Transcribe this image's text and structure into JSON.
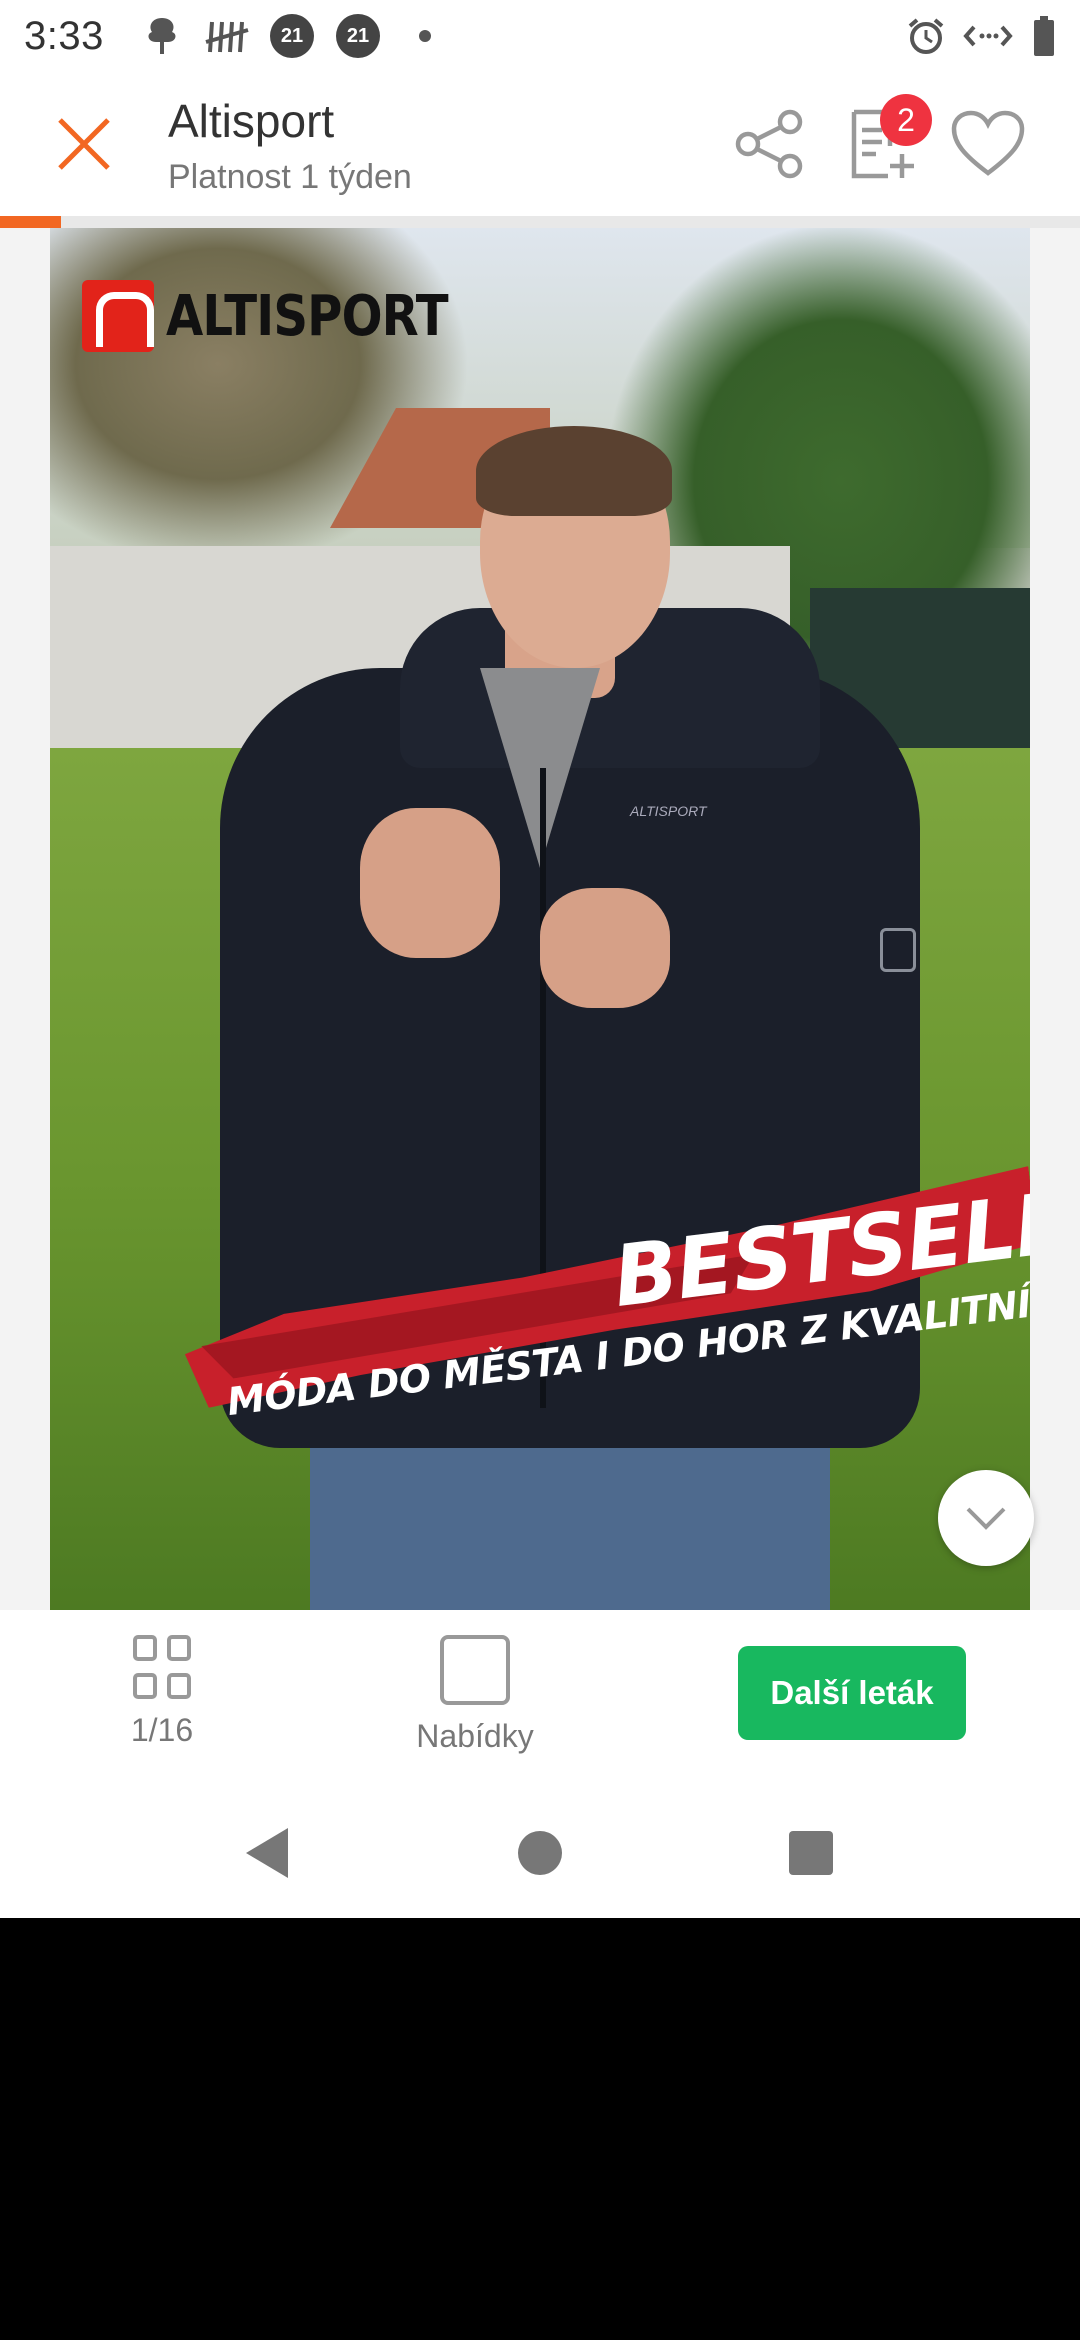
{
  "status_bar": {
    "time": "3:33",
    "badges": [
      "21",
      "21"
    ],
    "icons": [
      "notification-icon",
      "tally-icon",
      "alarm-icon",
      "data-icon",
      "battery-icon"
    ]
  },
  "header": {
    "title": "Altisport",
    "subtitle": "Platnost 1 týden",
    "cart_count": "2",
    "accent_color": "#f26722"
  },
  "progress": {
    "current_page": 1,
    "total_pages": 16
  },
  "flyer": {
    "brand": "ALTISPORT",
    "chest_logo": "ALTISPORT",
    "headline": "BESTSELLERY",
    "tagline": "MÓDA DO MĚSTA I DO HOR Z KVALITNÍHO MATERIÁLU"
  },
  "toolbar": {
    "pages_label": "1/16",
    "offers_label": "Nabídky",
    "next_button": "Další leták",
    "next_color": "#18b85f"
  }
}
